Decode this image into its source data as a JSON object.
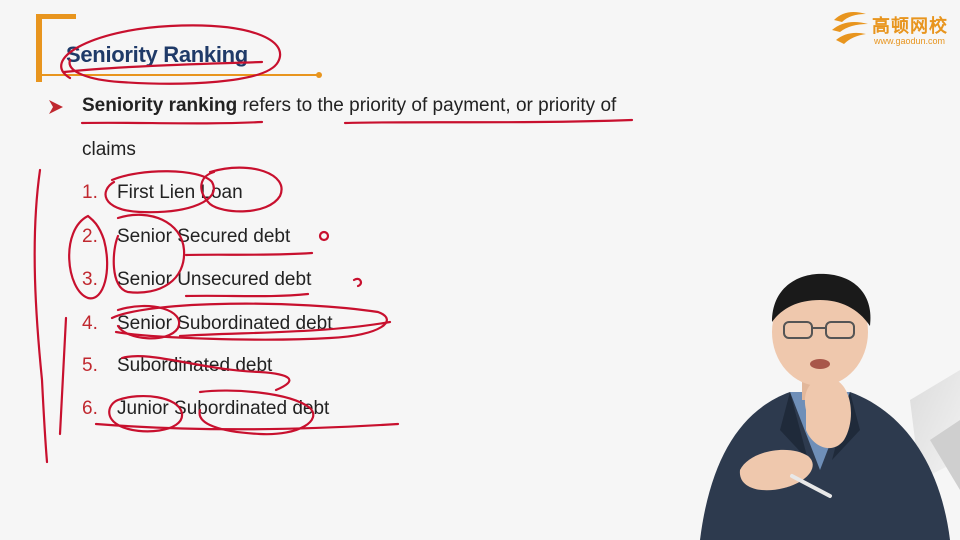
{
  "slide": {
    "title": "Seniority Ranking",
    "bullet": {
      "term": "Seniority ranking",
      "rest": " refers to the priority of payment, or priority of",
      "continuation": "claims"
    },
    "items": [
      {
        "num": "1.",
        "text": "First Lien Loan"
      },
      {
        "num": "2.",
        "text": "Senior Secured debt"
      },
      {
        "num": "3.",
        "text": "Senior Unsecured debt"
      },
      {
        "num": "4.",
        "text": "Senior Subordinated debt"
      },
      {
        "num": "5.",
        "text": "Subordinated debt"
      },
      {
        "num": "6.",
        "text": "Junior Subordinated debt"
      }
    ]
  },
  "logo": {
    "name": "高顿网校",
    "url": "www.gaodun.com"
  },
  "colors": {
    "title": "#1f3a68",
    "accent": "#e8951e",
    "number": "#c0282f",
    "ink": "#c8102e"
  }
}
